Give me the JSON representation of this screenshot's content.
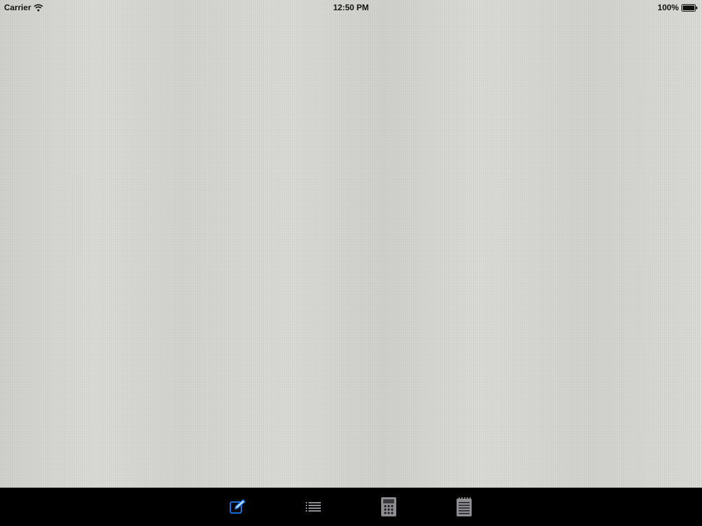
{
  "status_bar": {
    "carrier": "Carrier",
    "time": "12:50 PM",
    "battery": "100%"
  },
  "colors": {
    "tab_active": "#1a7cf5",
    "tab_inactive": "#8e8e93",
    "tab_bar_bg": "#000000",
    "background": "#d6d6d2"
  },
  "tab_bar": {
    "tabs": [
      {
        "icon": "compose-icon",
        "active": true
      },
      {
        "icon": "list-icon",
        "active": false
      },
      {
        "icon": "calculator-icon",
        "active": false
      },
      {
        "icon": "notepad-icon",
        "active": false
      }
    ]
  }
}
